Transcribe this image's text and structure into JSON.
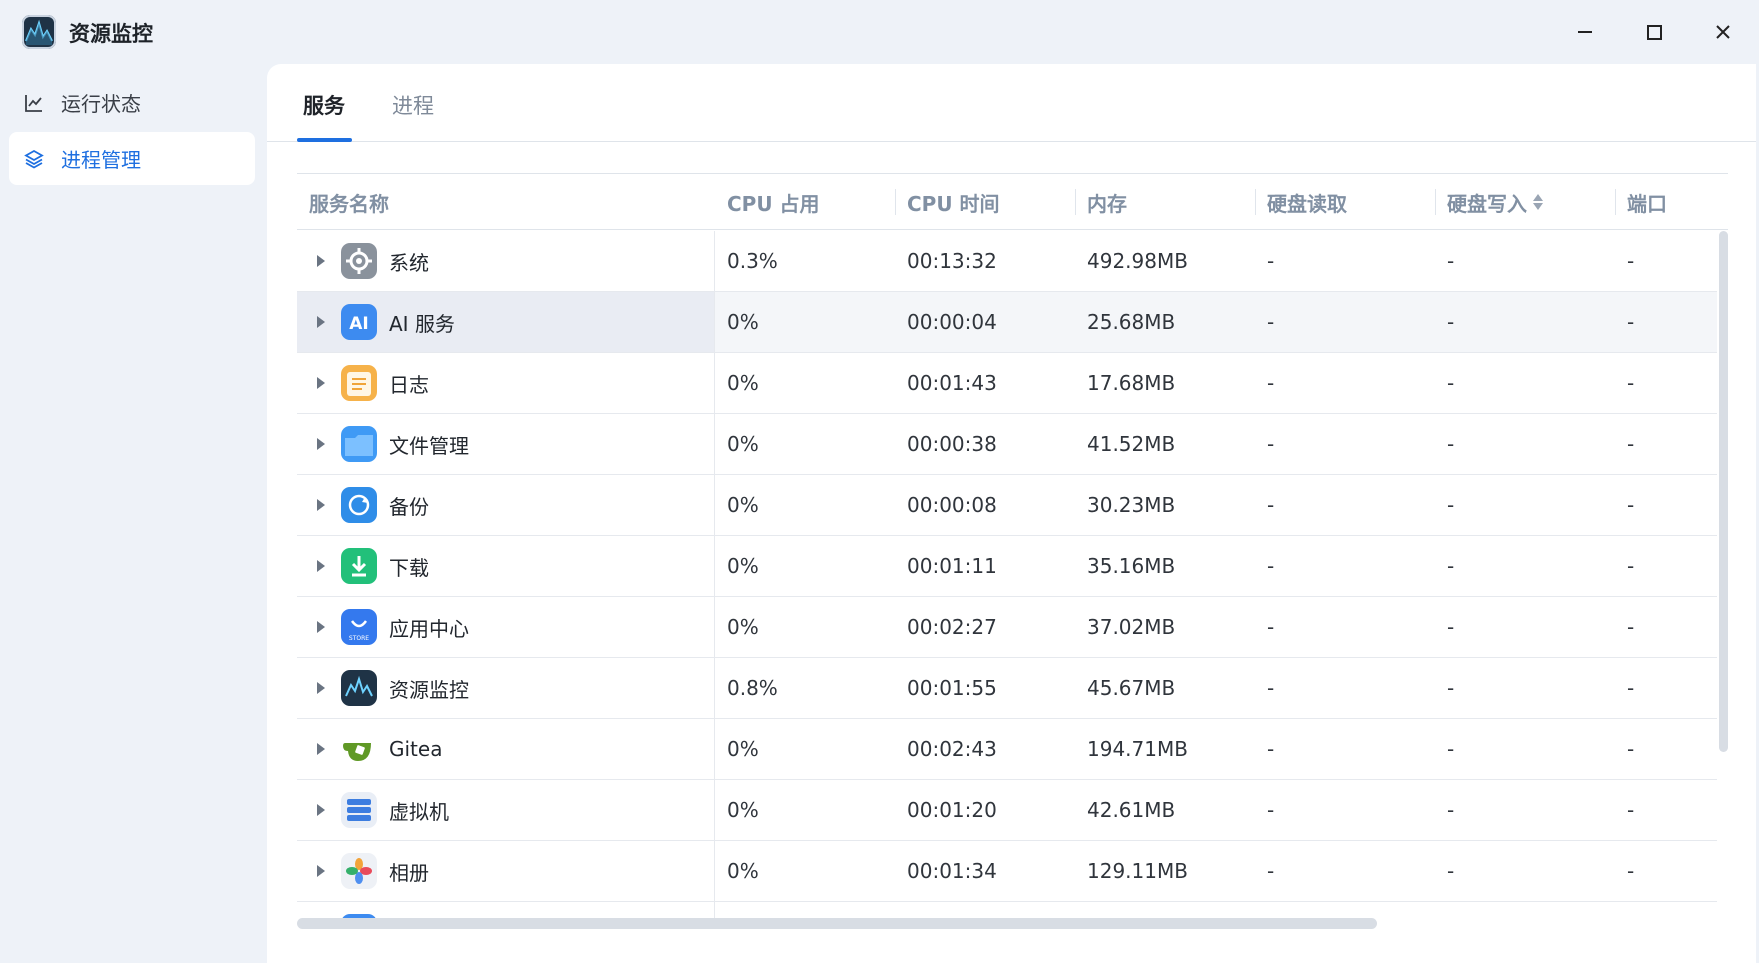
{
  "window": {
    "title": "资源监控",
    "controls": [
      "minimize",
      "maximize",
      "close"
    ]
  },
  "sidebar": {
    "items": [
      {
        "label": "运行状态",
        "icon": "line-chart-icon",
        "active": false
      },
      {
        "label": "进程管理",
        "icon": "layers-icon",
        "active": true
      }
    ]
  },
  "tabs": [
    {
      "label": "服务",
      "active": true
    },
    {
      "label": "进程",
      "active": false
    }
  ],
  "table": {
    "columns": [
      "服务名称",
      "CPU 占用",
      "CPU 时间",
      "内存",
      "硬盘读取",
      "硬盘写入",
      "端口"
    ],
    "sorted_column": "硬盘写入",
    "rows": [
      {
        "name": "系统",
        "icon": "gear-icon",
        "cpu": "0.3%",
        "time": "00:13:32",
        "mem": "492.98MB",
        "read": "-",
        "write": "-",
        "port": "-"
      },
      {
        "name": "AI 服务",
        "icon": "ai-icon",
        "cpu": "0%",
        "time": "00:00:04",
        "mem": "25.68MB",
        "read": "-",
        "write": "-",
        "port": "-"
      },
      {
        "name": "日志",
        "icon": "log-icon",
        "cpu": "0%",
        "time": "00:01:43",
        "mem": "17.68MB",
        "read": "-",
        "write": "-",
        "port": "-"
      },
      {
        "name": "文件管理",
        "icon": "folder-icon",
        "cpu": "0%",
        "time": "00:00:38",
        "mem": "41.52MB",
        "read": "-",
        "write": "-",
        "port": "-"
      },
      {
        "name": "备份",
        "icon": "backup-icon",
        "cpu": "0%",
        "time": "00:00:08",
        "mem": "30.23MB",
        "read": "-",
        "write": "-",
        "port": "-"
      },
      {
        "name": "下载",
        "icon": "download-icon",
        "cpu": "0%",
        "time": "00:01:11",
        "mem": "35.16MB",
        "read": "-",
        "write": "-",
        "port": "-"
      },
      {
        "name": "应用中心",
        "icon": "store-icon",
        "cpu": "0%",
        "time": "00:02:27",
        "mem": "37.02MB",
        "read": "-",
        "write": "-",
        "port": "-"
      },
      {
        "name": "资源监控",
        "icon": "monitor-icon",
        "cpu": "0.8%",
        "time": "00:01:55",
        "mem": "45.67MB",
        "read": "-",
        "write": "-",
        "port": "-"
      },
      {
        "name": "Gitea",
        "icon": "gitea-icon",
        "cpu": "0%",
        "time": "00:02:43",
        "mem": "194.71MB",
        "read": "-",
        "write": "-",
        "port": "-"
      },
      {
        "name": "虚拟机",
        "icon": "vm-icon",
        "cpu": "0%",
        "time": "00:01:20",
        "mem": "42.61MB",
        "read": "-",
        "write": "-",
        "port": "-"
      },
      {
        "name": "相册",
        "icon": "photos-icon",
        "cpu": "0%",
        "time": "00:01:34",
        "mem": "129.11MB",
        "read": "-",
        "write": "-",
        "port": "-"
      }
    ]
  },
  "colors": {
    "accent": "#1e6fe0",
    "background": "#eef2f8",
    "panel": "#ffffff"
  }
}
